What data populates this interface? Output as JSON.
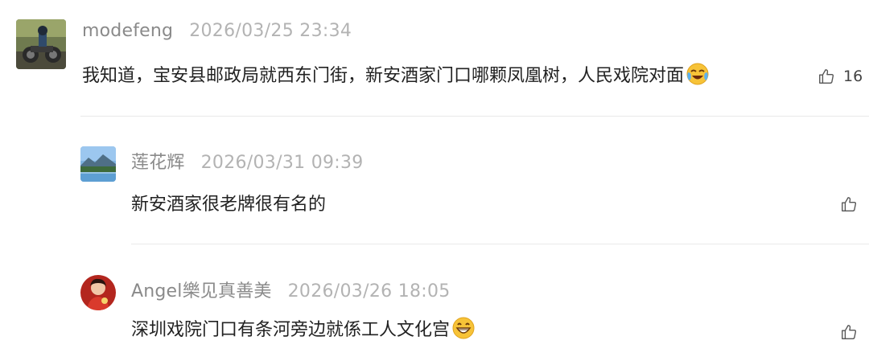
{
  "comments": [
    {
      "username": "modefeng",
      "timestamp": "2026/03/25 23:34",
      "text": "我知道，宝安县邮政局就西东门街，新安酒家门口哪颗凤凰树，人民戏院对面",
      "emoji": "crying-laughing-emoji",
      "likes": "16",
      "avatar": "motorcycle-rider-avatar"
    },
    {
      "username": "莲花辉",
      "timestamp": "2026/03/31 09:39",
      "text": "新安酒家很老牌很有名的",
      "likes": "",
      "avatar": "lake-mountain-avatar"
    },
    {
      "username": "Angel樂见真善美",
      "timestamp": "2026/03/26 18:05",
      "text": "深圳戏院门口有条河旁边就係工人文化宫",
      "emoji": "grinning-emoji",
      "likes": "",
      "avatar": "woman-portrait-avatar"
    }
  ],
  "colors": {
    "username": "#8a8a8a",
    "timestamp": "#b3b3b3",
    "text": "#222222",
    "divider": "#e9e9e9"
  },
  "icons": {
    "like": "thumbs-up-icon"
  }
}
